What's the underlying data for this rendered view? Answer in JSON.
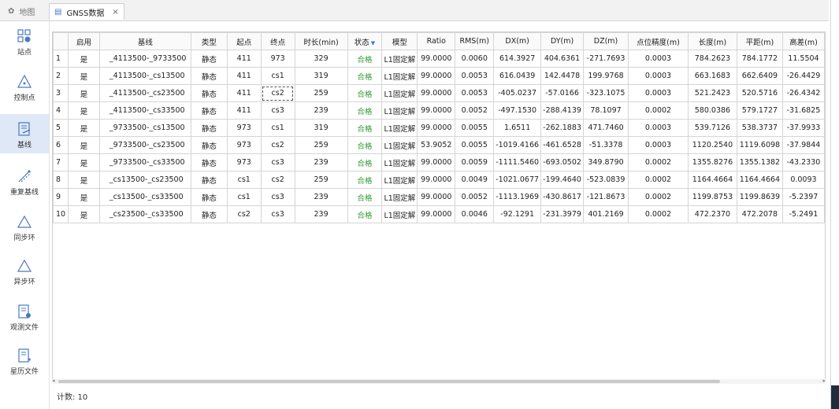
{
  "tabs": {
    "map_label": "地图",
    "gnss_label": "GNSS数据",
    "close_glyph": "×"
  },
  "sidebar": {
    "items": [
      {
        "label": "站点",
        "icon": "grid-dots-icon"
      },
      {
        "label": "控制点",
        "icon": "triangle-control-icon"
      },
      {
        "label": "基线",
        "icon": "baseline-doc-icon"
      },
      {
        "label": "重复基线",
        "icon": "repeat-baseline-icon"
      },
      {
        "label": "同步环",
        "icon": "sync-loop-icon"
      },
      {
        "label": "异步环",
        "icon": "async-loop-icon"
      },
      {
        "label": "观测文件",
        "icon": "observation-file-icon"
      },
      {
        "label": "星历文件",
        "icon": "ephemeris-file-icon"
      }
    ],
    "active_index": 2,
    "accent": "#4a78c2",
    "active_bg": "#dfe8f6"
  },
  "table": {
    "headers": [
      "",
      "启用",
      "基线",
      "类型",
      "起点",
      "终点",
      "时长(min)",
      "状态",
      "模型",
      "Ratio",
      "RMS(m)",
      "DX(m)",
      "DY(m)",
      "DZ(m)",
      "点位精度(m)",
      "长度(m)",
      "平距(m)",
      "高差(m)"
    ],
    "filter_glyph": "▼",
    "rows": [
      [
        "1",
        "是",
        "_4113500-_9733500",
        "静态",
        "411",
        "973",
        "329",
        "合格",
        "L1固定解",
        "99.0000",
        "0.0060",
        "614.3927",
        "404.6361",
        "-271.7693",
        "0.0003",
        "784.2623",
        "784.1772",
        "11.5504"
      ],
      [
        "2",
        "是",
        "_4113500-_cs13500",
        "静态",
        "411",
        "cs1",
        "319",
        "合格",
        "L1固定解",
        "99.0000",
        "0.0053",
        "616.0439",
        "142.4478",
        "199.9768",
        "0.0003",
        "663.1683",
        "662.6409",
        "-26.4429"
      ],
      [
        "3",
        "是",
        "_4113500-_cs23500",
        "静态",
        "411",
        "cs2",
        "259",
        "合格",
        "L1固定解",
        "99.0000",
        "0.0053",
        "-405.0237",
        "-57.0166",
        "-323.1075",
        "0.0003",
        "521.2423",
        "520.5716",
        "-26.4342"
      ],
      [
        "4",
        "是",
        "_4113500-_cs33500",
        "静态",
        "411",
        "cs3",
        "239",
        "合格",
        "L1固定解",
        "99.0000",
        "0.0052",
        "-497.1530",
        "-288.4139",
        "78.1097",
        "0.0002",
        "580.0386",
        "579.1727",
        "-31.6825"
      ],
      [
        "5",
        "是",
        "_9733500-_cs13500",
        "静态",
        "973",
        "cs1",
        "319",
        "合格",
        "L1固定解",
        "99.0000",
        "0.0055",
        "1.6511",
        "-262.1883",
        "471.7460",
        "0.0003",
        "539.7126",
        "538.3737",
        "-37.9933"
      ],
      [
        "6",
        "是",
        "_9733500-_cs23500",
        "静态",
        "973",
        "cs2",
        "259",
        "合格",
        "L1固定解",
        "53.9052",
        "0.0055",
        "-1019.4166",
        "-461.6528",
        "-51.3378",
        "0.0003",
        "1120.2540",
        "1119.6098",
        "-37.9844"
      ],
      [
        "7",
        "是",
        "_9733500-_cs33500",
        "静态",
        "973",
        "cs3",
        "239",
        "合格",
        "L1固定解",
        "99.0000",
        "0.0059",
        "-1111.5460",
        "-693.0502",
        "349.8790",
        "0.0002",
        "1355.8276",
        "1355.1382",
        "-43.2330"
      ],
      [
        "8",
        "是",
        "_cs13500-_cs23500",
        "静态",
        "cs1",
        "cs2",
        "259",
        "合格",
        "L1固定解",
        "99.0000",
        "0.0049",
        "-1021.0677",
        "-199.4640",
        "-523.0839",
        "0.0002",
        "1164.4664",
        "1164.4664",
        "0.0093"
      ],
      [
        "9",
        "是",
        "_cs13500-_cs33500",
        "静态",
        "cs1",
        "cs3",
        "239",
        "合格",
        "L1固定解",
        "99.0000",
        "0.0052",
        "-1113.1969",
        "-430.8617",
        "-121.8673",
        "0.0002",
        "1199.8753",
        "1199.8639",
        "-5.2397"
      ],
      [
        "10",
        "是",
        "_cs23500-_cs33500",
        "静态",
        "cs2",
        "cs3",
        "239",
        "合格",
        "L1固定解",
        "99.0000",
        "0.0046",
        "-92.1291",
        "-231.3979",
        "401.2169",
        "0.0002",
        "472.2370",
        "472.2078",
        "-5.2491"
      ]
    ],
    "pass_color": "#2e9a2e"
  },
  "footer": {
    "count_text": "计数: 10"
  }
}
